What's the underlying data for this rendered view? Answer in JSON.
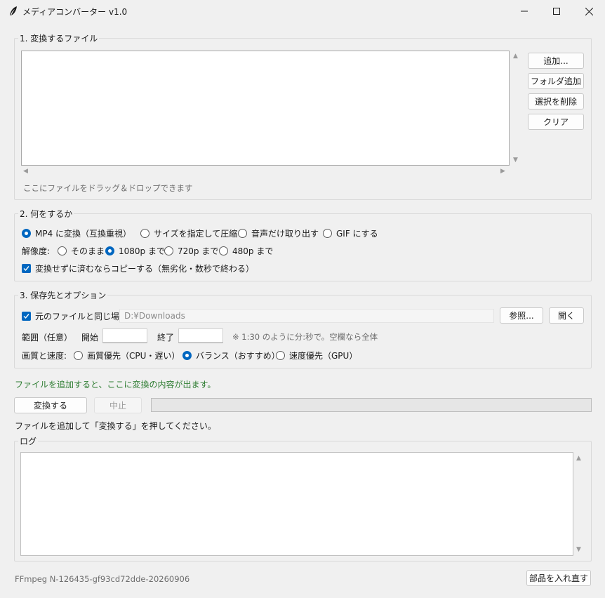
{
  "window": {
    "title": "メディアコンバーター v1.0",
    "icon": "feather-icon"
  },
  "files_group": {
    "label": "1. 変換するファイル",
    "drop_hint": "ここにファイルをドラッグ＆ドロップできます",
    "buttons": {
      "add": "追加...",
      "add_folder": "フォルダ追加",
      "remove_selected": "選択を削除",
      "clear": "クリア"
    }
  },
  "action_group": {
    "label": "2. 何をするか",
    "modes": [
      {
        "label": "MP4 に変換（互換重視）",
        "selected": true
      },
      {
        "label": "サイズを指定して圧縮",
        "selected": false
      },
      {
        "label": "音声だけ取り出す",
        "selected": false
      },
      {
        "label": "GIF にする",
        "selected": false
      }
    ],
    "resolution_label": "解像度:",
    "resolutions": [
      {
        "label": "そのまま",
        "selected": false
      },
      {
        "label": "1080p まで",
        "selected": true
      },
      {
        "label": "720p まで",
        "selected": false
      },
      {
        "label": "480p まで",
        "selected": false
      }
    ],
    "copy_option": {
      "label": "変換せずに済むならコピーする（無劣化・数秒で終わる）",
      "checked": true
    }
  },
  "output_group": {
    "label": "3. 保存先とオプション",
    "same_location": {
      "label": "元のファイルと同じ場所",
      "checked": true
    },
    "path_value": "D:¥Downloads",
    "browse_button": "参照...",
    "open_button": "開く",
    "range_label": "範囲（任意）",
    "start_label": "開始",
    "start_value": "",
    "end_label": "終了",
    "end_value": "",
    "range_hint": "※ 1:30 のように分:秒で。空欄なら全体",
    "quality_label": "画質と速度:",
    "qualities": [
      {
        "label": "画質優先（CPU・遅い）",
        "selected": false
      },
      {
        "label": "バランス（おすすめ）",
        "selected": true
      },
      {
        "label": "速度優先（GPU）",
        "selected": false
      }
    ]
  },
  "summary_text": "ファイルを追加すると、ここに変換の内容が出ます。",
  "convert_button": "変換する",
  "stop_button": "中止",
  "progress": 0,
  "status_text": "ファイルを追加して「変換する」を押してください。",
  "log_group": {
    "label": "ログ"
  },
  "footer": {
    "ffmpeg_version": "FFmpeg N-126435-gf93cd72dde-20260906",
    "reinstall_button": "部品を入れ直す"
  },
  "colors": {
    "accent": "#0067c0",
    "summary_green": "#2e7d32",
    "background": "#f0f0f0"
  }
}
